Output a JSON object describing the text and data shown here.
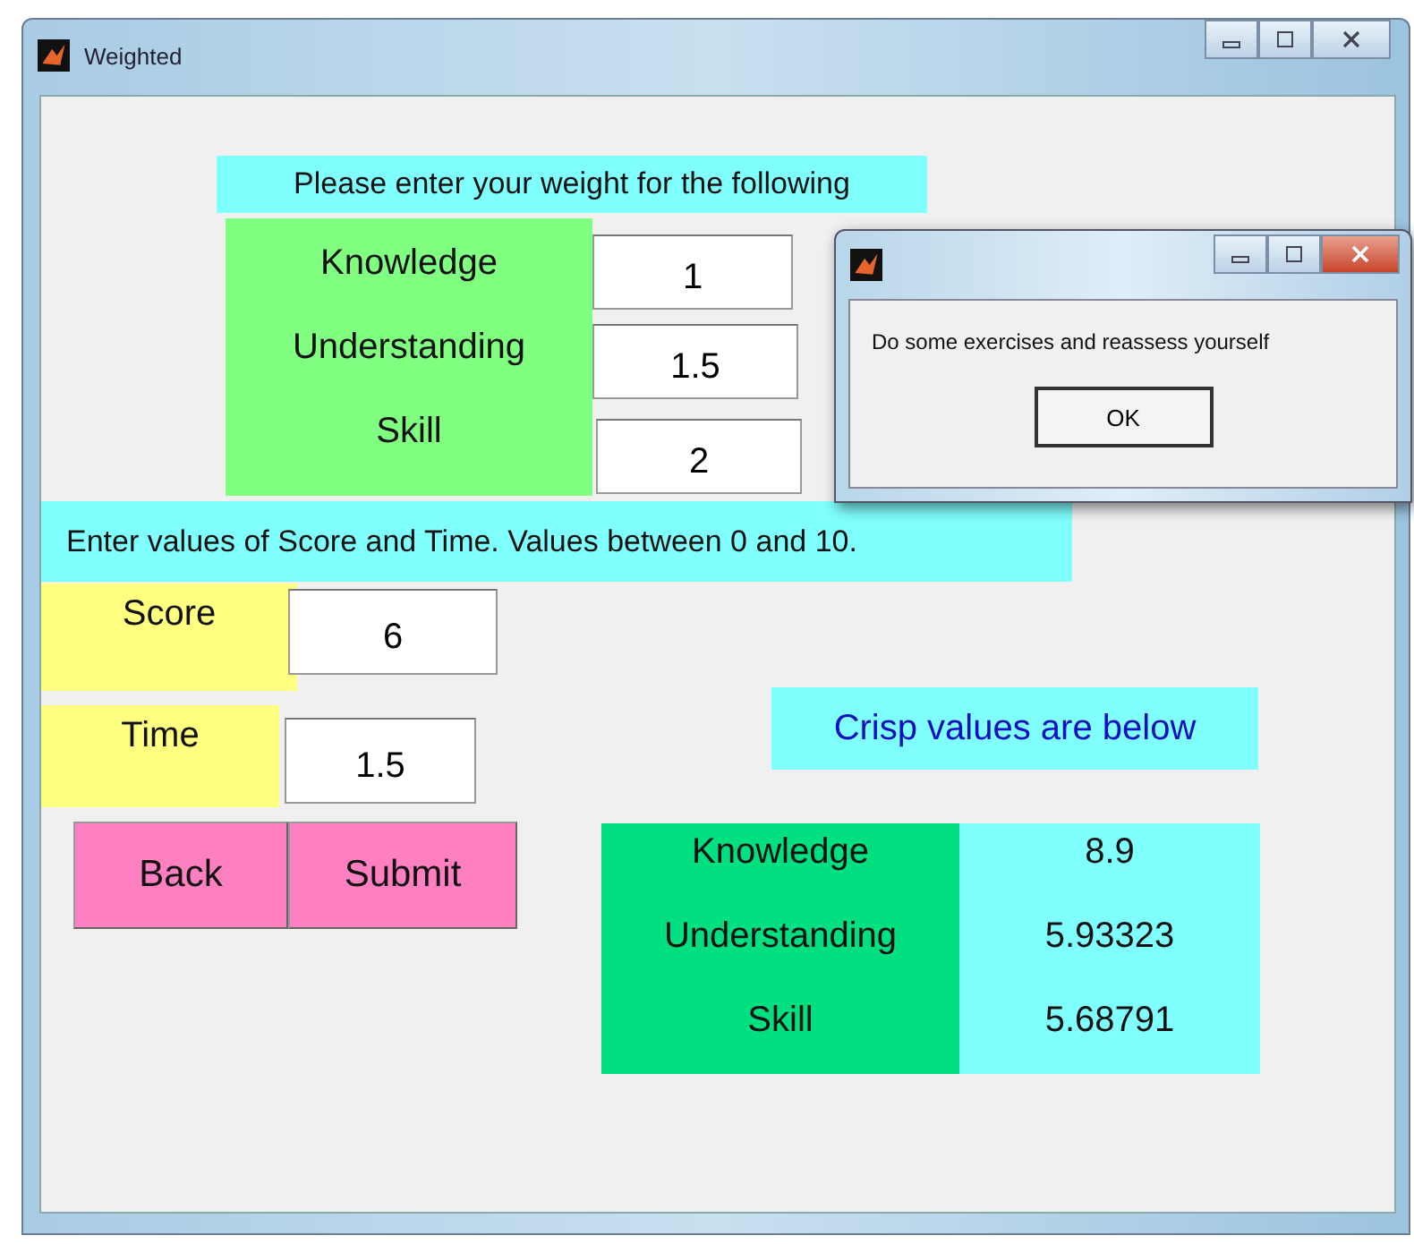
{
  "window": {
    "title": "Weighted"
  },
  "weights": {
    "heading": "Please enter your weight for the following",
    "items": [
      {
        "label": "Knowledge",
        "value": "1"
      },
      {
        "label": "Understanding",
        "value": "1.5"
      },
      {
        "label": "Skill",
        "value": "2"
      }
    ]
  },
  "instruction": "Enter values of Score and Time. Values between 0 and 10.",
  "inputs": [
    {
      "label": "Score",
      "value": "6"
    },
    {
      "label": "Time",
      "value": "1.5"
    }
  ],
  "buttons": [
    {
      "label": "Back"
    },
    {
      "label": "Submit"
    }
  ],
  "results": {
    "heading": "Crisp values are below",
    "items": [
      {
        "label": "Knowledge",
        "value": "8.9"
      },
      {
        "label": "Understanding",
        "value": "5.93323"
      },
      {
        "label": "Skill",
        "value": "5.68791"
      }
    ]
  },
  "dialog": {
    "message": "Do some exercises and reassess yourself",
    "button": "OK"
  }
}
